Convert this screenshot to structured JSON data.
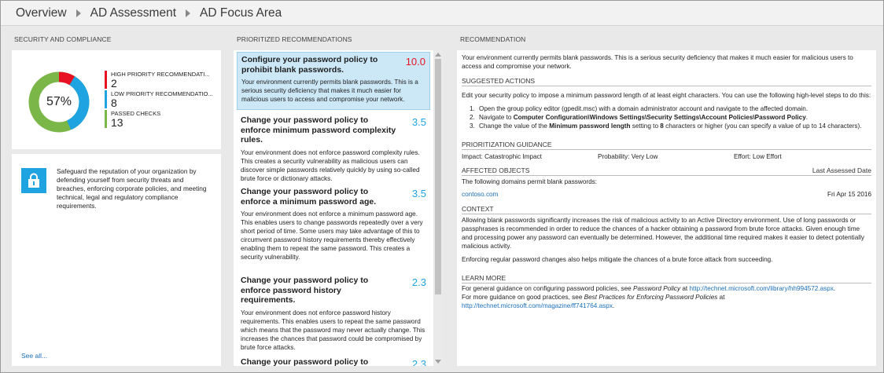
{
  "breadcrumb": [
    "Overview",
    "AD Assessment",
    "AD Focus Area"
  ],
  "sections": {
    "security": "SECURITY AND COMPLIANCE",
    "prioritized": "PRIORITIZED RECOMMENDATIONS",
    "recommendation": "RECOMMENDATION"
  },
  "summary": {
    "percent": "57%",
    "percent_value": 57,
    "high_label": "HIGH PRIORITY RECOMMENDATI...",
    "high_value": "2",
    "low_label": "LOW PRIORITY RECOMMENDATIO...",
    "low_value": "8",
    "passed_label": "PASSED CHECKS",
    "passed_value": "13",
    "colors": {
      "high": "#e81123",
      "low": "#20a3e1",
      "passed": "#7ab648"
    }
  },
  "info": {
    "text": "Safeguard the reputation of your organization by defending yourself from security threats and breaches, enforcing corporate policies, and meeting technical, legal and regulatory compliance requirements.",
    "see_all": "See all...",
    "icon": "lock-icon"
  },
  "recommendations": [
    {
      "title": "Configure your password policy to prohibit blank passwords.",
      "score": "10.0",
      "score_color": "#e81123",
      "desc": "Your environment currently permits blank passwords. This is a serious security deficiency that makes it much easier for malicious users to access and compromise your network."
    },
    {
      "title": "Change your password policy to enforce minimum password complexity rules.",
      "score": "3.5",
      "score_color": "#20a3e1",
      "desc": "Your environment does not enforce password complexity rules. This creates a security vulnerability as malicious users can discover simple passwords relatively quickly by using so-called brute force or dictionary attacks."
    },
    {
      "title": "Change your password policy to enforce a minimum password age.",
      "score": "3.5",
      "score_color": "#20a3e1",
      "desc": "Your environment does not enforce a minimum password age. This enables users to change passwords repeatedly over a very short period of time. Some users may take advantage of this to circumvent password history requirements thereby effectively enabling them to repeat the same password. This creates a security vulnerability."
    },
    {
      "title": "Change your password policy to enforce password history requirements.",
      "score": "2.3",
      "score_color": "#20a3e1",
      "desc": "Your environment does not enforce password history requirements. This enables users to repeat the same password which means that the password may never actually change. This increases the chances that password could be compromised by brute force attacks."
    },
    {
      "title": "Change your password policy to enforce",
      "score": "2.3",
      "score_color": "#20a3e1",
      "desc": ""
    }
  ],
  "detail": {
    "intro": "Your environment currently permits blank passwords. This is a serious security deficiency that makes it much easier for malicious users to access and compromise your network.",
    "suggested_head": "SUGGESTED ACTIONS",
    "suggested_text": "Edit your security policy to impose a minimum password length of at least eight characters. You can use the following high-level steps to do this:",
    "step1": "Open the group policy editor (gpedit.msc) with a domain administrator account and navigate to the affected domain.",
    "step2_pre": "Navigate to ",
    "step2_bold": "Computer Configuration\\Windows Settings\\Security Settings\\Account Policies\\Password Policy",
    "step2_post": ".",
    "step3_pre": "Change the value of the ",
    "step3_bold": "Minimum password length",
    "step3_mid": " setting to ",
    "step3_bold2": "8",
    "step3_post": " characters or higher (you can specify a value of up to 14 characters).",
    "prior_head": "PRIORITIZATION GUIDANCE",
    "impact": "Impact:  Catastrophic Impact",
    "probability": "Probability:  Very Low",
    "effort": "Effort:  Low Effort",
    "affected_head": "AFFECTED OBJECTS",
    "last_assessed": "Last Assessed Date",
    "affected_text": "The following domains permit blank passwords:",
    "domain": "contoso.com",
    "domain_date": "Fri Apr 15 2016",
    "context_head": "CONTEXT",
    "context1": "Allowing blank passwords significantly increases the risk of malicious activity to an Active Directory environment. Use of long passwords or passphrases is recommended in order to reduce the chances of a hacker obtaining a password from brute force attacks. Given enough time and processing power any password can eventually be determined. However, the additional time required makes it easier to detect potentially malicious activity.",
    "context2": "Enforcing regular password changes also helps mitigate the chances of a brute force attack from succeeding.",
    "learn_head": "LEARN MORE",
    "learn1_pre": "For general guidance on configuring password policies, see ",
    "learn1_italic": "Password Policy",
    "learn1_mid": " at ",
    "learn1_link": "http://technet.microsoft.com/library/hh994572.aspx",
    "learn1_post": ".",
    "learn2_pre": "For more guidance on good practices, see ",
    "learn2_italic": "Best Practices for Enforcing Password Policies",
    "learn2_mid": " at",
    "learn2_link": "http://technet.microsoft.com/magazine/ff741764.aspx",
    "learn2_post": "."
  }
}
